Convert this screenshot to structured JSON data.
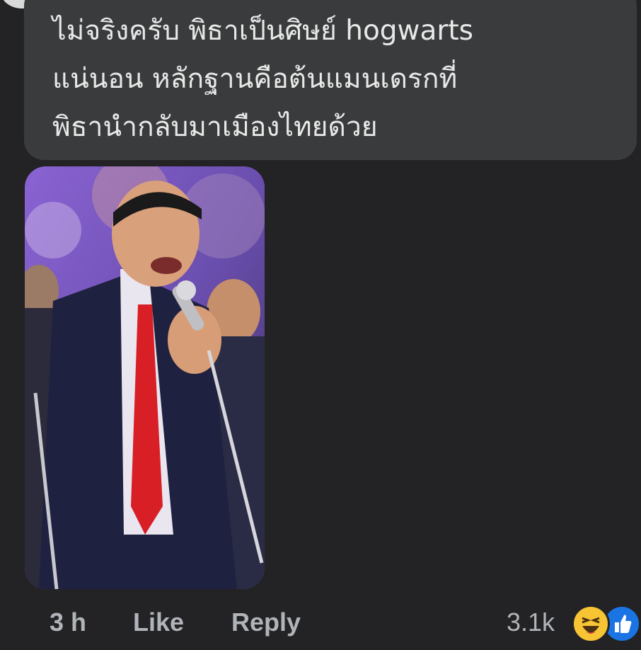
{
  "comment": {
    "lines": [
      "ไม่จริงครับ พิธาเป็นศิษย์ hogwarts",
      "แน่นอน หลักฐานคือต้นแมนเดรกที่",
      "พิธานำกลับมาเมืองไทยด้วย"
    ]
  },
  "footer": {
    "time": "3 h",
    "like_label": "Like",
    "reply_label": "Reply",
    "reaction_count": "3.1k",
    "reactions": [
      "haha-icon",
      "like-icon"
    ]
  },
  "colors": {
    "background": "#232325",
    "bubble": "#3a3b3c",
    "text": "#e8e8e8",
    "muted": "#b0b3b8",
    "like_blue": "#1b74e4",
    "haha_yellow": "#f7c534"
  }
}
